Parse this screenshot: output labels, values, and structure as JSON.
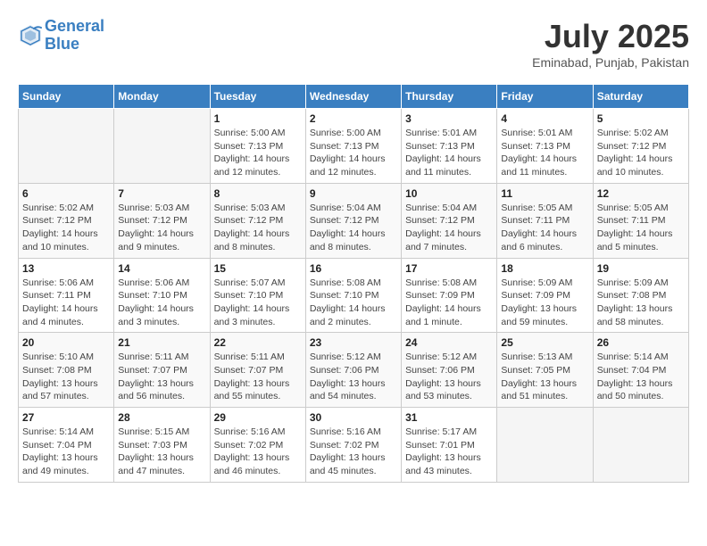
{
  "header": {
    "logo_line1": "General",
    "logo_line2": "Blue",
    "month": "July 2025",
    "location": "Eminabad, Punjab, Pakistan"
  },
  "columns": [
    "Sunday",
    "Monday",
    "Tuesday",
    "Wednesday",
    "Thursday",
    "Friday",
    "Saturday"
  ],
  "weeks": [
    [
      {
        "day": "",
        "detail": ""
      },
      {
        "day": "",
        "detail": ""
      },
      {
        "day": "1",
        "detail": "Sunrise: 5:00 AM\nSunset: 7:13 PM\nDaylight: 14 hours\nand 12 minutes."
      },
      {
        "day": "2",
        "detail": "Sunrise: 5:00 AM\nSunset: 7:13 PM\nDaylight: 14 hours\nand 12 minutes."
      },
      {
        "day": "3",
        "detail": "Sunrise: 5:01 AM\nSunset: 7:13 PM\nDaylight: 14 hours\nand 11 minutes."
      },
      {
        "day": "4",
        "detail": "Sunrise: 5:01 AM\nSunset: 7:13 PM\nDaylight: 14 hours\nand 11 minutes."
      },
      {
        "day": "5",
        "detail": "Sunrise: 5:02 AM\nSunset: 7:12 PM\nDaylight: 14 hours\nand 10 minutes."
      }
    ],
    [
      {
        "day": "6",
        "detail": "Sunrise: 5:02 AM\nSunset: 7:12 PM\nDaylight: 14 hours\nand 10 minutes."
      },
      {
        "day": "7",
        "detail": "Sunrise: 5:03 AM\nSunset: 7:12 PM\nDaylight: 14 hours\nand 9 minutes."
      },
      {
        "day": "8",
        "detail": "Sunrise: 5:03 AM\nSunset: 7:12 PM\nDaylight: 14 hours\nand 8 minutes."
      },
      {
        "day": "9",
        "detail": "Sunrise: 5:04 AM\nSunset: 7:12 PM\nDaylight: 14 hours\nand 8 minutes."
      },
      {
        "day": "10",
        "detail": "Sunrise: 5:04 AM\nSunset: 7:12 PM\nDaylight: 14 hours\nand 7 minutes."
      },
      {
        "day": "11",
        "detail": "Sunrise: 5:05 AM\nSunset: 7:11 PM\nDaylight: 14 hours\nand 6 minutes."
      },
      {
        "day": "12",
        "detail": "Sunrise: 5:05 AM\nSunset: 7:11 PM\nDaylight: 14 hours\nand 5 minutes."
      }
    ],
    [
      {
        "day": "13",
        "detail": "Sunrise: 5:06 AM\nSunset: 7:11 PM\nDaylight: 14 hours\nand 4 minutes."
      },
      {
        "day": "14",
        "detail": "Sunrise: 5:06 AM\nSunset: 7:10 PM\nDaylight: 14 hours\nand 3 minutes."
      },
      {
        "day": "15",
        "detail": "Sunrise: 5:07 AM\nSunset: 7:10 PM\nDaylight: 14 hours\nand 3 minutes."
      },
      {
        "day": "16",
        "detail": "Sunrise: 5:08 AM\nSunset: 7:10 PM\nDaylight: 14 hours\nand 2 minutes."
      },
      {
        "day": "17",
        "detail": "Sunrise: 5:08 AM\nSunset: 7:09 PM\nDaylight: 14 hours\nand 1 minute."
      },
      {
        "day": "18",
        "detail": "Sunrise: 5:09 AM\nSunset: 7:09 PM\nDaylight: 13 hours\nand 59 minutes."
      },
      {
        "day": "19",
        "detail": "Sunrise: 5:09 AM\nSunset: 7:08 PM\nDaylight: 13 hours\nand 58 minutes."
      }
    ],
    [
      {
        "day": "20",
        "detail": "Sunrise: 5:10 AM\nSunset: 7:08 PM\nDaylight: 13 hours\nand 57 minutes."
      },
      {
        "day": "21",
        "detail": "Sunrise: 5:11 AM\nSunset: 7:07 PM\nDaylight: 13 hours\nand 56 minutes."
      },
      {
        "day": "22",
        "detail": "Sunrise: 5:11 AM\nSunset: 7:07 PM\nDaylight: 13 hours\nand 55 minutes."
      },
      {
        "day": "23",
        "detail": "Sunrise: 5:12 AM\nSunset: 7:06 PM\nDaylight: 13 hours\nand 54 minutes."
      },
      {
        "day": "24",
        "detail": "Sunrise: 5:12 AM\nSunset: 7:06 PM\nDaylight: 13 hours\nand 53 minutes."
      },
      {
        "day": "25",
        "detail": "Sunrise: 5:13 AM\nSunset: 7:05 PM\nDaylight: 13 hours\nand 51 minutes."
      },
      {
        "day": "26",
        "detail": "Sunrise: 5:14 AM\nSunset: 7:04 PM\nDaylight: 13 hours\nand 50 minutes."
      }
    ],
    [
      {
        "day": "27",
        "detail": "Sunrise: 5:14 AM\nSunset: 7:04 PM\nDaylight: 13 hours\nand 49 minutes."
      },
      {
        "day": "28",
        "detail": "Sunrise: 5:15 AM\nSunset: 7:03 PM\nDaylight: 13 hours\nand 47 minutes."
      },
      {
        "day": "29",
        "detail": "Sunrise: 5:16 AM\nSunset: 7:02 PM\nDaylight: 13 hours\nand 46 minutes."
      },
      {
        "day": "30",
        "detail": "Sunrise: 5:16 AM\nSunset: 7:02 PM\nDaylight: 13 hours\nand 45 minutes."
      },
      {
        "day": "31",
        "detail": "Sunrise: 5:17 AM\nSunset: 7:01 PM\nDaylight: 13 hours\nand 43 minutes."
      },
      {
        "day": "",
        "detail": ""
      },
      {
        "day": "",
        "detail": ""
      }
    ]
  ]
}
